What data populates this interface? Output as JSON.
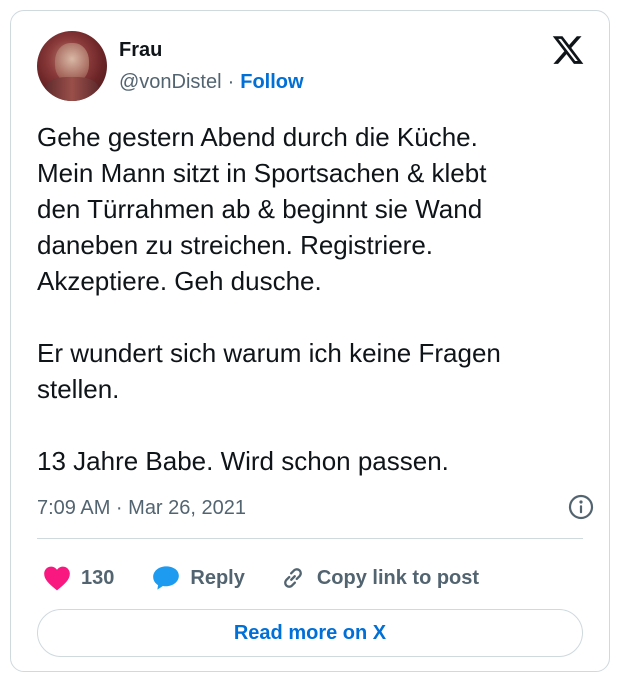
{
  "author": {
    "display_name": "Frau",
    "handle": "@vonDistel",
    "separator": "·",
    "follow_label": "Follow"
  },
  "brand": {
    "logo_icon": "x-logo-icon"
  },
  "tweet": {
    "text": "Gehe gestern Abend durch die Küche.\nMein Mann sitzt in Sportsachen & klebt\nden Türrahmen ab & beginnt sie Wand\ndaneben zu streichen. Registriere.\nAkzeptiere. Geh dusche.\n\nEr wundert sich warum ich keine Fragen\nstellen.\n\n13 Jahre Babe. Wird schon passen.",
    "timestamp": "7:09 AM · Mar 26, 2021",
    "info_icon": "info-icon"
  },
  "actions": {
    "like_count": "130",
    "like_icon": "heart-icon",
    "reply_label": "Reply",
    "reply_icon": "speech-bubble-icon",
    "copy_label": "Copy link to post",
    "copy_icon": "link-icon"
  },
  "footer": {
    "read_more_label": "Read more on X"
  },
  "colors": {
    "accent_blue": "#006fd6",
    "heart_pink": "#f91880",
    "reply_blue": "#1d9bf0",
    "muted_text": "#536471",
    "border": "#cfd9de"
  }
}
